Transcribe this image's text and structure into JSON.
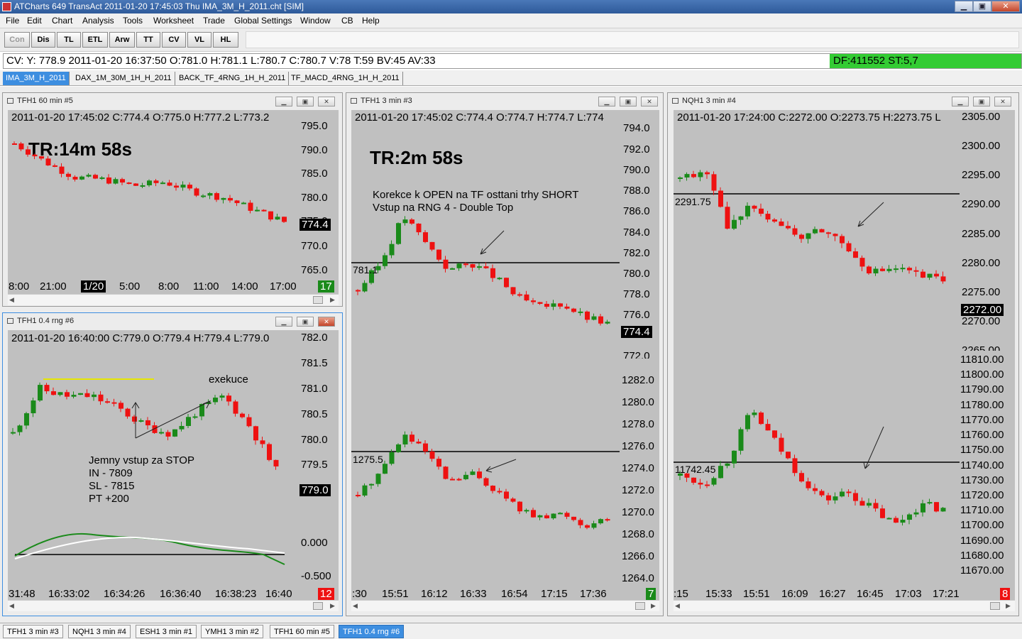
{
  "window": {
    "title": "ATCharts 649  TransAct 2011-01-20  17:45:03  Thu   IMA_3M_H_2011.cht [SIM]",
    "min": "▁",
    "max": "▣",
    "close": "✕"
  },
  "menu": [
    "File",
    "Edit",
    "Chart",
    "Analysis",
    "Tools",
    "Worksheet",
    "Trade",
    "Global Settings",
    "Window",
    "CB",
    "Help"
  ],
  "toolbar": [
    "Con",
    "Dis",
    "TL",
    "ETL",
    "Arw",
    "TT",
    "CV",
    "VL",
    "HL"
  ],
  "status": {
    "text": "CV: Y: 778.9  2011-01-20  16:37:50  O:781.0  H:781.1  L:780.7  C:780.7  V:78  T:59  BV:45  AV:33",
    "df": "DF:411552  ST:5,7"
  },
  "worksheet_tabs": [
    "IMA_3M_H_2011",
    "DAX_1M_30M_1H_H_2011",
    "BACK_TF_4RNG_1H_H_2011",
    "TF_MACD_4RNG_1H_H_2011"
  ],
  "colors": {
    "up": "#1a8a1a",
    "down": "#ee1111",
    "plot_bg": "#c0c0c0"
  },
  "charts": {
    "c1": {
      "title": "TFH1  60 min   #5",
      "ohlc": "2011-01-20 17:45:02 C:774.4  O:775.0  H:777.2  L:773.2",
      "tr": "TR:14m 58s",
      "yticks": [
        "795.0",
        "790.0",
        "785.0",
        "780.0",
        "775.0",
        "770.0",
        "765.0"
      ],
      "price": "774.4",
      "xticks": [
        "8:00",
        "21:00",
        "1/20",
        "5:00",
        "8:00",
        "11:00",
        "14:00",
        "17:00"
      ],
      "badge": "17"
    },
    "c2": {
      "title": "TFH1  0.4 rng   #6",
      "ohlc": "2011-01-20 16:40:00 C:779.0  O:779.4  H:779.4  L:779.0",
      "yticks": [
        "782.0",
        "781.5",
        "781.0",
        "780.5",
        "780.0",
        "779.5"
      ],
      "price": "779.0",
      "oscticks": [
        "0.000",
        "-0.500"
      ],
      "xticks": [
        "31:48",
        "16:33:02",
        "16:34:26",
        "16:36:40",
        "16:38:23",
        "16:40"
      ],
      "badge": "12",
      "annotation": "exekuce",
      "note": [
        "Jemny vstup za STOP",
        "IN  - 7809",
        "SL - 7815",
        "PT +200"
      ]
    },
    "c3": {
      "title": "TFH1  3 min   #3",
      "ohlc": "2011-01-20 17:45:02 C:774.4  O:774.7  H:774.7  L:774",
      "tr": "TR:2m 58s",
      "note": [
        "Korekce k OPEN  na TF osttani trhy SHORT",
        "Vstup na RNG 4 -  Double Top"
      ],
      "yticks": [
        "794.0",
        "792.0",
        "790.0",
        "788.0",
        "786.0",
        "784.0",
        "782.0",
        "780.0",
        "778.0",
        "776.0",
        "774.0",
        "772.0"
      ],
      "price": "774.4",
      "level": "781.1",
      "yticks2": [
        "1282.0",
        "1280.0",
        "1278.0",
        "1276.0",
        "1274.0",
        "1272.0",
        "1270.0",
        "1268.0",
        "1266.0",
        "1264.0"
      ],
      "level2": "1275.5",
      "xticks": [
        ":30",
        "15:51",
        "16:12",
        "16:33",
        "16:54",
        "17:15",
        "17:36"
      ],
      "badge": "7"
    },
    "c4": {
      "title": "NQH1  3 min   #4",
      "ohlc": "2011-01-20 17:24:00 C:2272.00  O:2273.75  H:2273.75  L",
      "yticks": [
        "2305.00",
        "2300.00",
        "2295.00",
        "2290.00",
        "2285.00",
        "2280.00",
        "2275.00",
        "2270.00",
        "2265.00"
      ],
      "price": "2272.00",
      "level": "2291.75",
      "yticks2": [
        "11810.00",
        "11800.00",
        "11790.00",
        "11780.00",
        "11770.00",
        "11760.00",
        "11750.00",
        "11740.00",
        "11730.00",
        "11720.00",
        "11710.00",
        "11700.00",
        "11690.00",
        "11680.00",
        "11670.00"
      ],
      "level2": "11742.45",
      "xticks": [
        ":15",
        "15:33",
        "15:51",
        "16:09",
        "16:27",
        "16:45",
        "17:03",
        "17:21"
      ],
      "badge": "8"
    }
  },
  "bottom_tabs": [
    "TFH1  3 min    #3",
    "NQH1  3 min    #4",
    "ESH1  3 min    #1",
    "YMH1  3 min   #2",
    "TFH1  60 min    #5",
    "TFH1  0.4 rng   #6"
  ]
}
